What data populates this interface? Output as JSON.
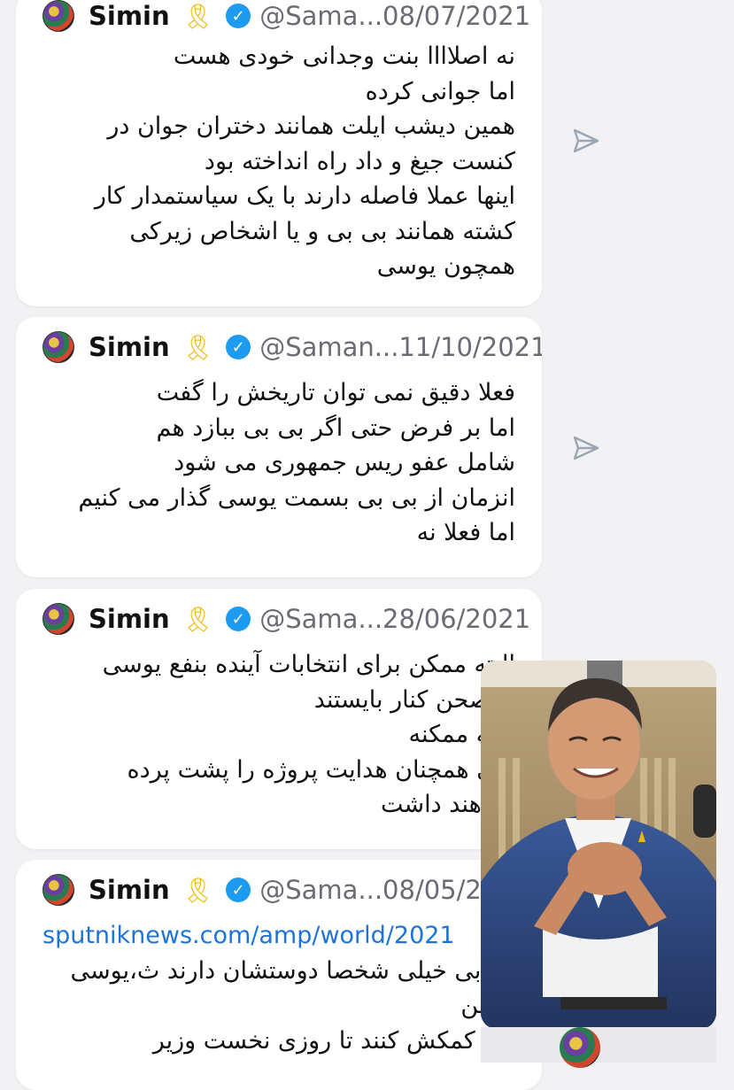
{
  "tweets": [
    {
      "name": "Simin",
      "ribbon": "🎗",
      "verified": "✓",
      "handle": "@Sama...",
      "date": "08/07/2021",
      "lines": [
        "نه اصلاااا بنت وجدانی خودی هست",
        "اما جوانی کرده",
        "همین دیشب ایلت همانند دختران جوان در",
        "کنست جیغ و داد راه انداخته بود",
        "اینها عملا فاصله دارند با یک سیاستمدار کار",
        "کشته همانند بی بی و یا اشخاص زیرکی",
        "همچون یوسی"
      ]
    },
    {
      "name": "Simin",
      "ribbon": "🎗",
      "verified": "✓",
      "handle": "@Saman...",
      "date": "11/10/2021",
      "lines": [
        "فعلا دقیق نمی توان تاریخش را گفت",
        "اما بر فرض حتی اگر بی بی ببازد هم",
        "شامل عفو ریس جمهوری می شود",
        "انزمان از بی بی بسمت یوسی گذار می کنیم",
        "اما فعلا نه"
      ]
    },
    {
      "name": "Simin",
      "ribbon": "🎗",
      "verified": "✓",
      "handle": "@Sama...",
      "date": "28/06/2021",
      "lines": [
        "البته ممکن برای انتخابات آینده بنفع یوسی",
        "از صحن کنار بایستند",
        "همه ممکنه",
        "ولی همچنان هدایت پروژه را پشت پرده",
        "خواهند داشت"
      ]
    },
    {
      "name": "Simin",
      "ribbon": "🎗",
      "verified": "✓",
      "handle": "@Sama...",
      "date": "08/05/2021",
      "link": "sputniknews.com/amp/world/2021",
      "lines": [
        "بی بی خیلی شخصا دوستشان دارند ث،یوسی",
        "کوهن",
        "هرا کمکش کنند تا روزی نخست وزیر"
      ]
    }
  ],
  "video_overlay": {
    "subject": "man in blue suit smiling with clasped hands"
  },
  "colors": {
    "accent_link": "#1d74d8",
    "verified": "#1d9bf0",
    "ribbon": "#f2b705",
    "muted_text": "#6b6b73",
    "send_icon": "#9aa6b2"
  }
}
